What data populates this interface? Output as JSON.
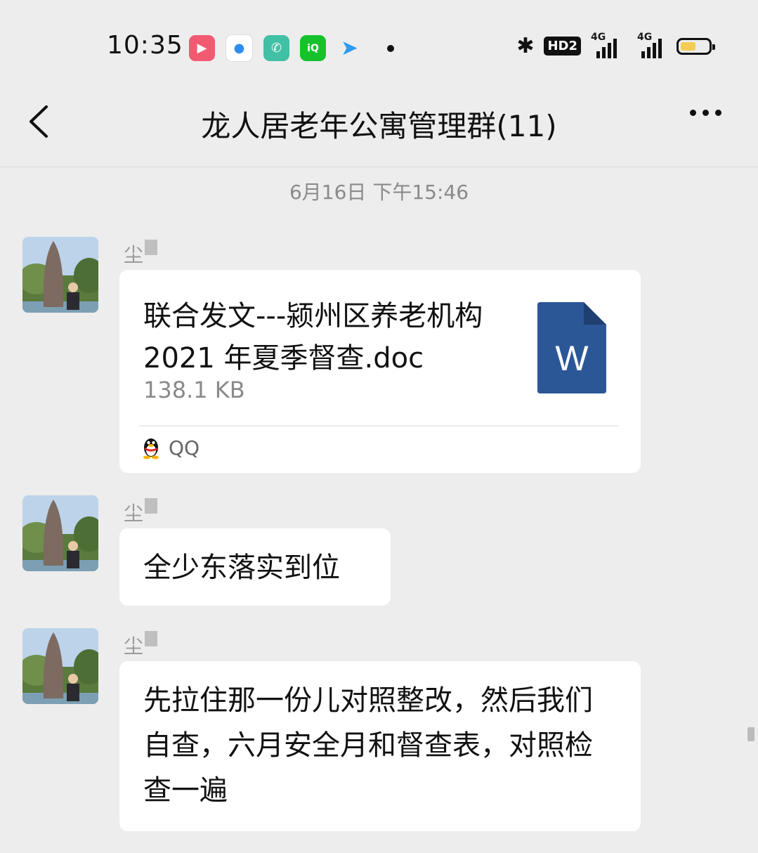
{
  "status_bar": {
    "time": "10:35",
    "apps": [
      {
        "icon": "video-app-icon",
        "glyph": "▶",
        "color": "#f25a72"
      },
      {
        "icon": "circle-app-icon",
        "glyph": "●",
        "color": "#2e8cf0"
      },
      {
        "icon": "phone-app-icon",
        "glyph": "✆",
        "color": "#40c0a4"
      },
      {
        "icon": "iqiyi-app-icon",
        "glyph": "iQ",
        "color": "#16c22c"
      },
      {
        "icon": "paper-plane-app-icon",
        "glyph": "➤",
        "color": "#2d9bf0"
      }
    ],
    "hd_label": "HD2",
    "signal1_label": "4G",
    "signal2_label": "4G",
    "battery_level": 0.55
  },
  "nav": {
    "title": "龙人居老年公寓管理群(11)"
  },
  "timestamp": "6月16日 下午15:46",
  "messages": [
    {
      "sender": "尘",
      "type": "file",
      "file_name": "联合发文---颍州区养老机构 2021 年夏季督查.doc",
      "file_size": "138.1 KB",
      "file_icon_letter": "W",
      "source": "QQ"
    },
    {
      "sender": "尘",
      "type": "text",
      "text": "全少东落实到位"
    },
    {
      "sender": "尘",
      "type": "text",
      "text": "先拉住那一份儿对照整改，然后我们自查，六月安全月和督查表，对照检查一遍"
    }
  ]
}
